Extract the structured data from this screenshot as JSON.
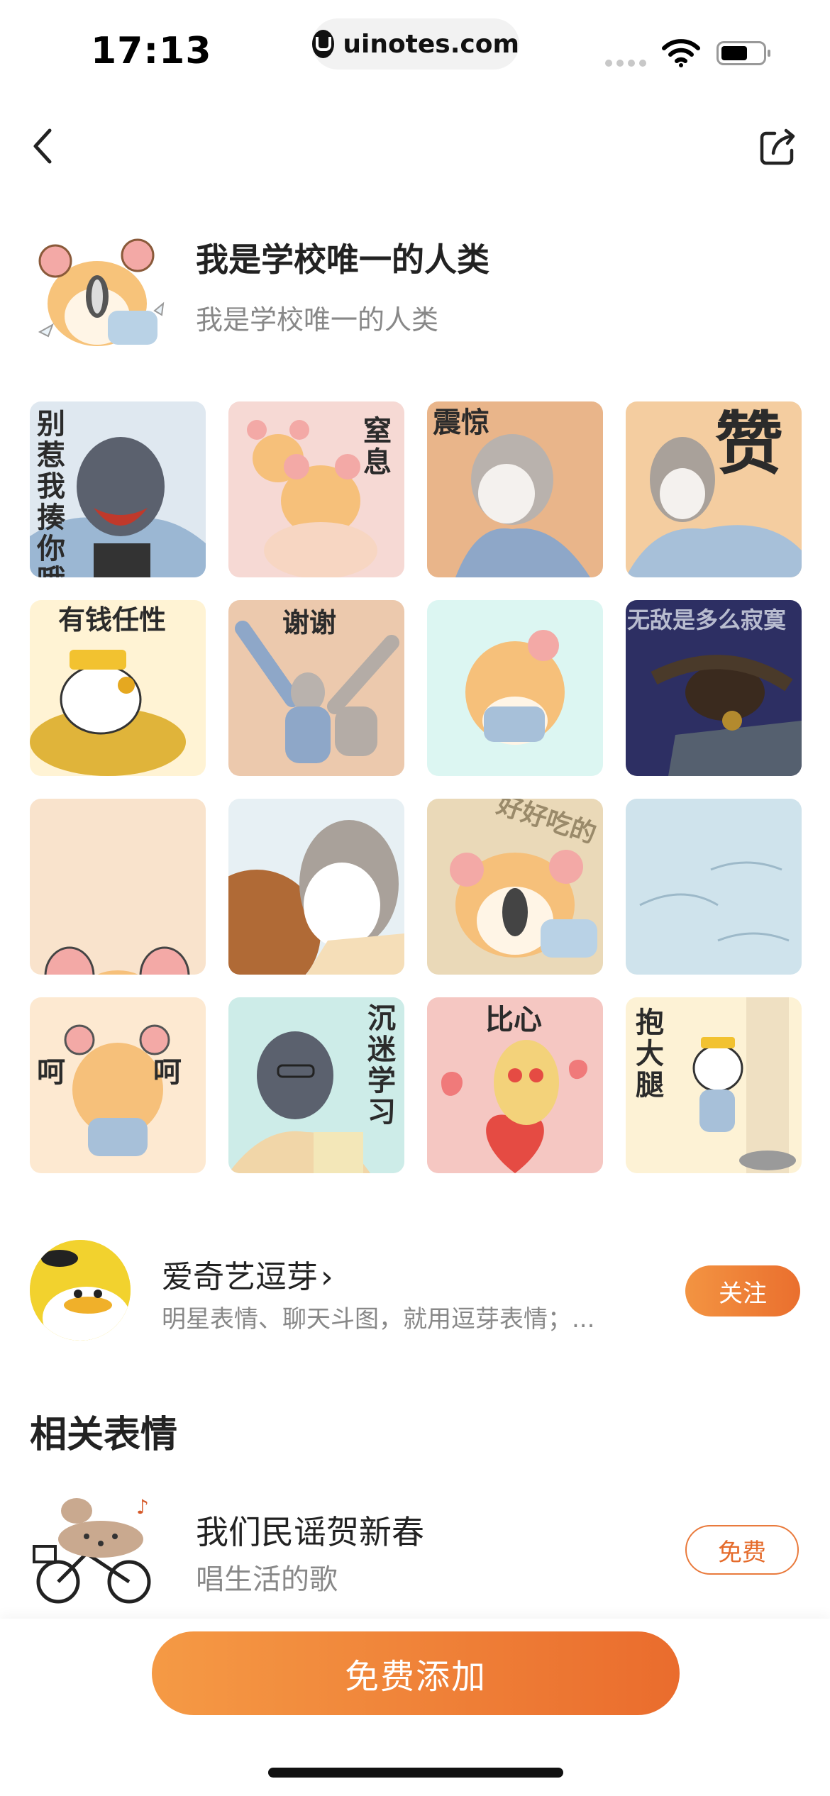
{
  "status_bar": {
    "time": "17:13",
    "url": "uinotes.com"
  },
  "nav": {
    "back_icon": "chevron-left-icon",
    "share_icon": "share-icon"
  },
  "pack": {
    "title": "我是学校唯一的人类",
    "subtitle": "我是学校唯一的人类"
  },
  "stickers": [
    {
      "caption": "别惹我 揍你哦",
      "bg": "#dfe8f0"
    },
    {
      "caption": "窒息",
      "bg": "#f6d9d4"
    },
    {
      "caption": "震惊",
      "bg": "#e9b58a"
    },
    {
      "caption": "赞",
      "bg": "#f4cda0"
    },
    {
      "caption": "有钱任性",
      "bg": "#fff3d4"
    },
    {
      "caption": "谢谢",
      "bg": "#ecc9ad"
    },
    {
      "caption": "",
      "bg": "#dcf6f2"
    },
    {
      "caption": "无敌是多么寂寞",
      "bg": "#2d2f63"
    },
    {
      "caption": "",
      "bg": "#f9e3cc"
    },
    {
      "caption": "",
      "bg": "#e7f0f4"
    },
    {
      "caption": "好好吃的",
      "bg": "#ead9b8"
    },
    {
      "caption": "",
      "bg": "#cfe3ec"
    },
    {
      "caption": "呵 呵",
      "bg": "#fde9d1"
    },
    {
      "caption": "沉迷学习",
      "bg": "#cdece8"
    },
    {
      "caption": "比心",
      "bg": "#f5c7c2"
    },
    {
      "caption": "抱大腿",
      "bg": "#fdf2d5"
    }
  ],
  "author": {
    "name": "爱奇艺逗芽",
    "chevron": "›",
    "description": "明星表情、聊天斗图，就用逗芽表情；...",
    "follow_label": "关注"
  },
  "related": {
    "heading": "相关表情",
    "items": [
      {
        "title": "我们民谣贺新春",
        "subtitle": "唱生活的歌",
        "badge": "免费"
      }
    ]
  },
  "bottom": {
    "add_label": "免费添加"
  },
  "colors": {
    "accent": "#ee7a35",
    "text_primary": "#222222",
    "text_secondary": "#888888"
  }
}
